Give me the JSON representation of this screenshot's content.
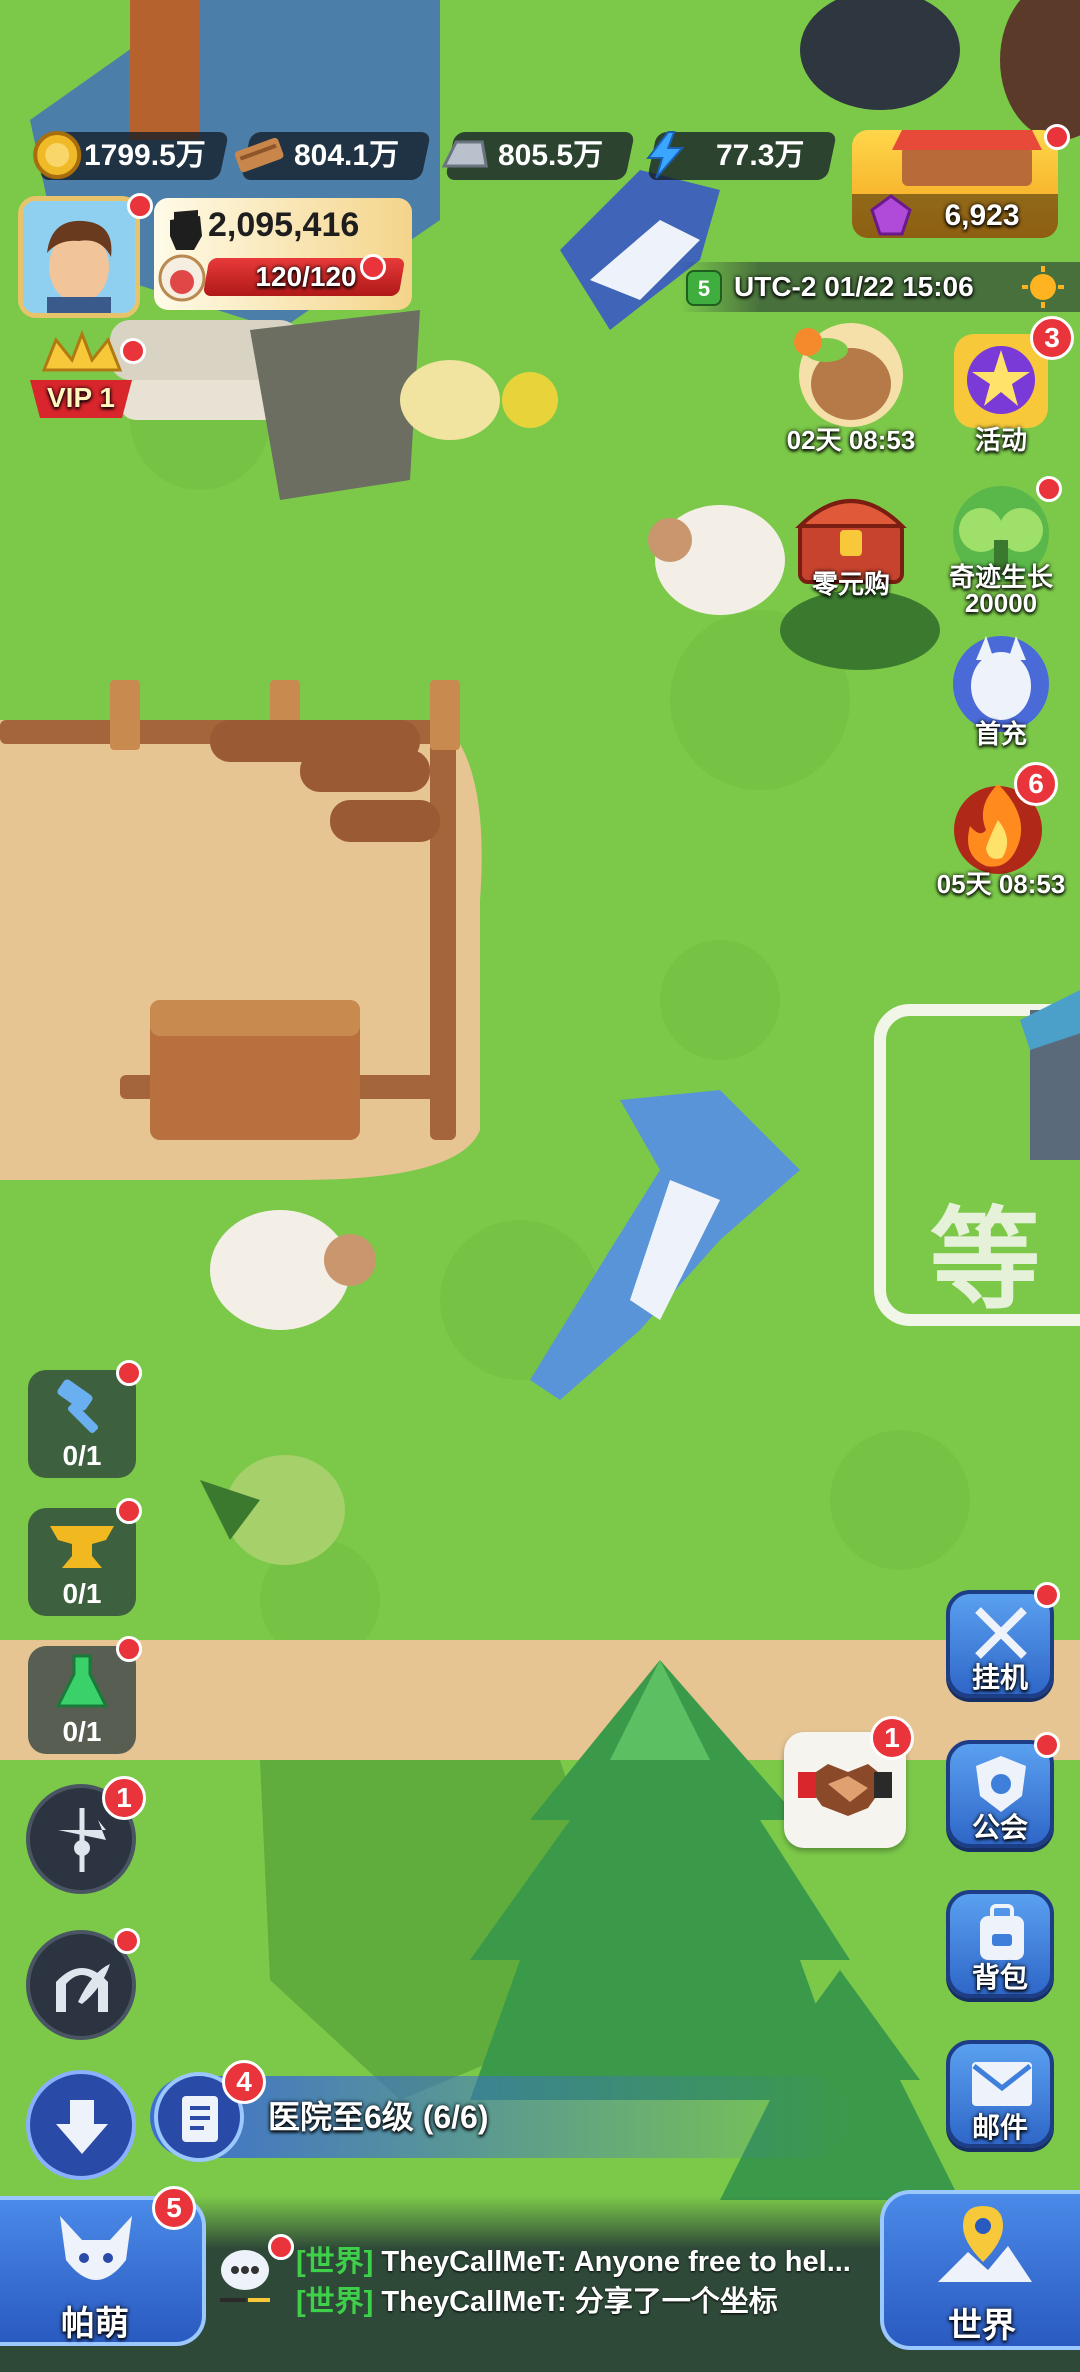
{
  "resources": [
    {
      "icon": "gold-coin-icon",
      "value": "1799.5万"
    },
    {
      "icon": "wood-plank-icon",
      "value": "804.1万"
    },
    {
      "icon": "iron-ingot-icon",
      "value": "805.5万"
    },
    {
      "icon": "lightning-icon",
      "value": "77.3万"
    }
  ],
  "shop": {
    "gems": "6,923"
  },
  "player": {
    "power": "2,095,416",
    "stamina": "120/120",
    "vip": "VIP 1"
  },
  "server": {
    "level": "5",
    "time": "UTC-2  01/22 15:06"
  },
  "events": {
    "timer1": "02天 08:53",
    "activity": {
      "label": "活动",
      "badge": "3"
    },
    "zero_buy": "零元购",
    "miracle": "奇迹生长\n20000",
    "miracle_l1": "奇迹生长",
    "miracle_l2": "20000",
    "first_charge": "首充",
    "timer2": {
      "label": "05天 08:53",
      "badge": "6"
    }
  },
  "ground_text": "等",
  "tools": [
    {
      "icon": "hammer-icon",
      "count": "0/1"
    },
    {
      "icon": "anvil-icon",
      "count": "0/1"
    },
    {
      "icon": "flask-icon",
      "count": "0/1"
    }
  ],
  "left_round": [
    {
      "icon": "weathervane-icon",
      "badge": "1"
    },
    {
      "icon": "arch-feather-icon"
    },
    {
      "icon": "speed-arrow-icon"
    }
  ],
  "right_menu": [
    {
      "icon": "swords-icon",
      "label": "挂机"
    },
    {
      "icon": "guild-shield-icon",
      "label": "公会"
    },
    {
      "icon": "backpack-icon",
      "label": "背包"
    },
    {
      "icon": "mail-icon",
      "label": "邮件"
    }
  ],
  "trade": {
    "badge": "1"
  },
  "quest": {
    "badge": "4",
    "text": "医院至6级 (6/6)"
  },
  "bottom": {
    "pets": {
      "label": "帕萌",
      "badge": "5"
    },
    "world": {
      "label": "世界"
    },
    "chat": [
      {
        "channel": "[世界]",
        "sender": "TheyCallMeT:",
        "msg": "Anyone free to hel..."
      },
      {
        "channel": "[世界]",
        "sender": "TheyCallMeT:",
        "msg": "分享了一个坐标"
      }
    ]
  },
  "colors": {
    "badge": "#e8343a",
    "grass": "#7cc94a",
    "menu_blue": "#3f7fdc",
    "quest_blue": "#3d6fd0"
  }
}
